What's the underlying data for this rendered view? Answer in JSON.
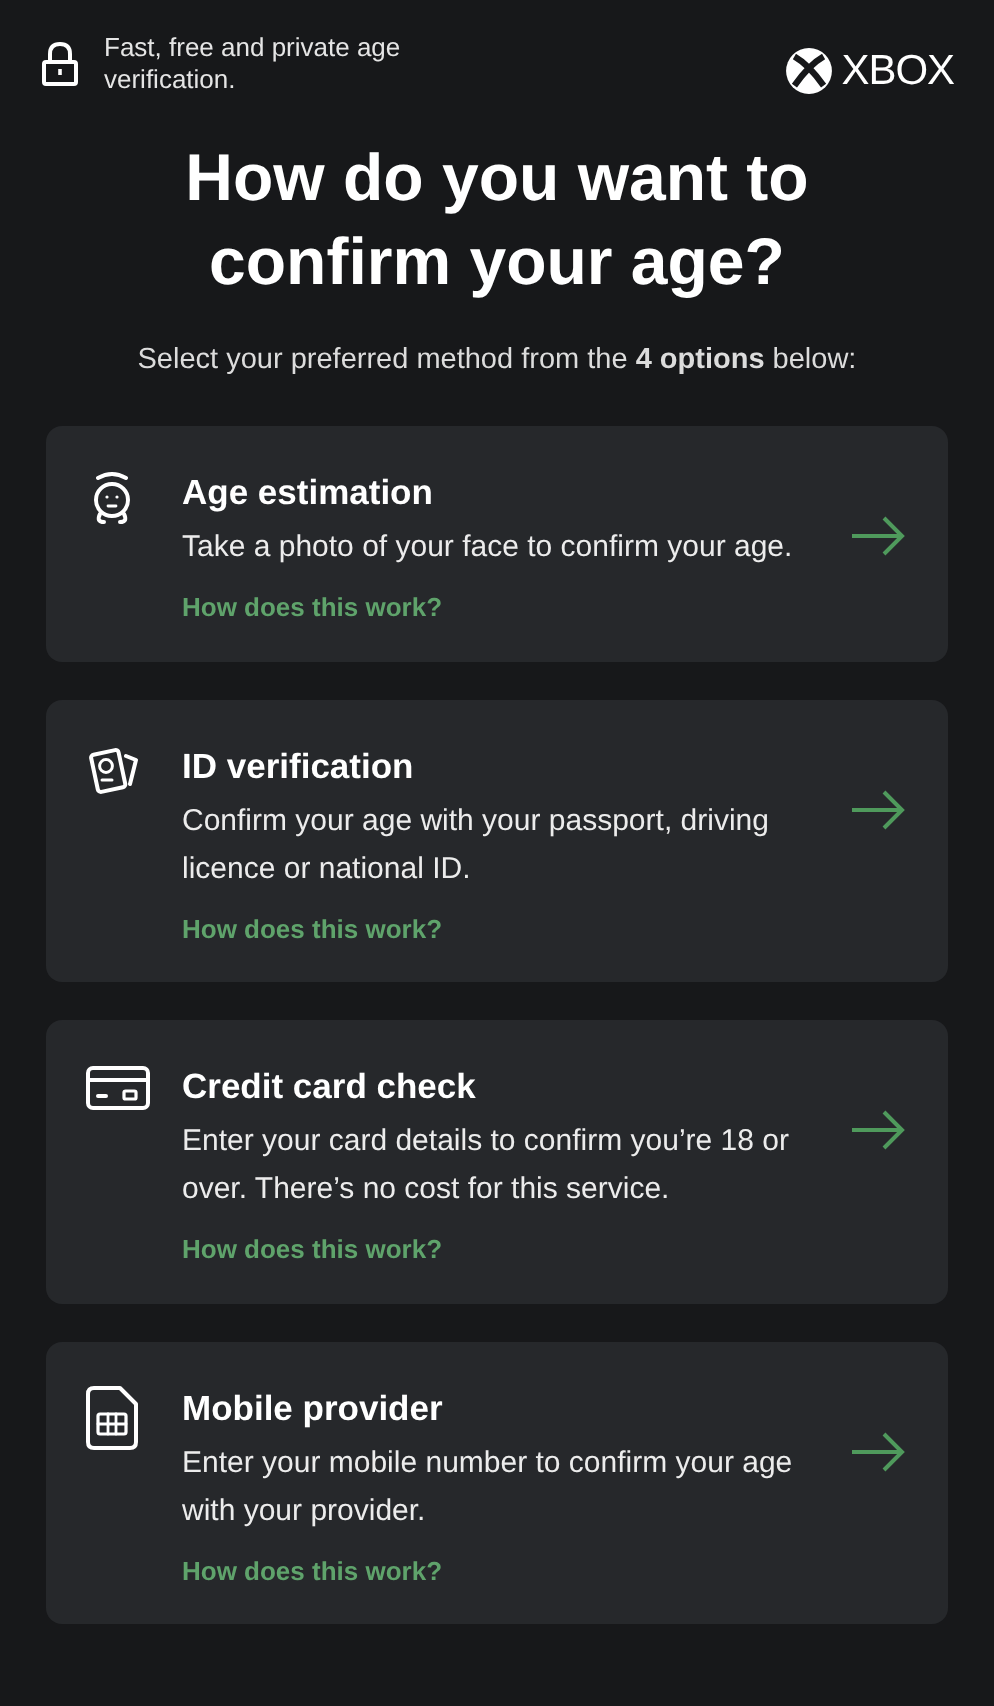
{
  "header": {
    "tagline": "Fast, free and private age verification.",
    "brand": "XBOX"
  },
  "title": "How do you want to confirm your age?",
  "subtitle": "Select your preferred method from the **4 options** below:",
  "options": [
    {
      "kind": "face",
      "title": "Age estimation",
      "description": "Take a photo of your face to confirm your age.",
      "link": "How does this work?"
    },
    {
      "kind": "passport",
      "title": "ID verification",
      "description": "Confirm your age with your passport, driving licence or national ID.",
      "link": "How does this work?"
    },
    {
      "kind": "card",
      "title": "Credit card check",
      "description": "Enter your card details to confirm you’re 18 or over. There’s no cost for this service.",
      "link": "How does this work?"
    },
    {
      "kind": "sim",
      "title": "Mobile provider",
      "description": "Enter your mobile number to confirm your age with your provider.",
      "link": "How does this work?"
    }
  ]
}
